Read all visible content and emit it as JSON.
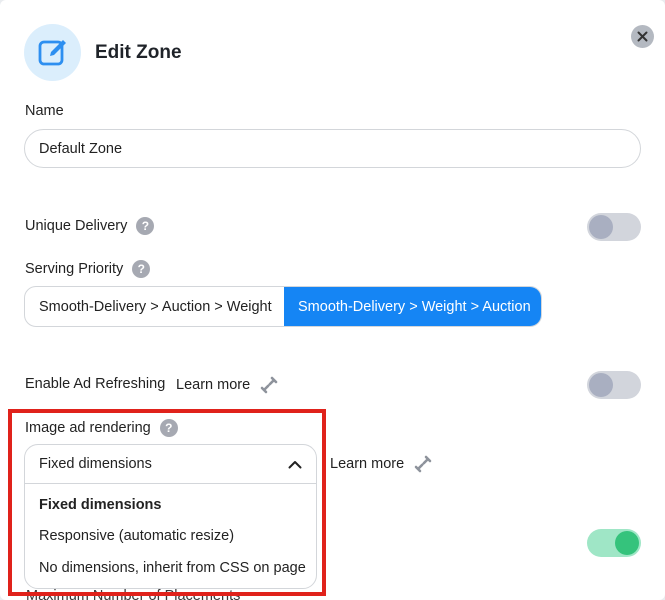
{
  "modal": {
    "title": "Edit Zone"
  },
  "name": {
    "label": "Name",
    "value": "Default Zone"
  },
  "unique_delivery": {
    "label": "Unique Delivery",
    "help": "?",
    "enabled": false
  },
  "serving_priority": {
    "label": "Serving Priority",
    "help": "?",
    "options": [
      "Smooth-Delivery > Auction > Weight",
      "Smooth-Delivery > Weight > Auction"
    ],
    "selected": "Smooth-Delivery > Weight > Auction"
  },
  "ad_refreshing": {
    "label": "Enable Ad Refreshing",
    "learn_more": "Learn more",
    "enabled": false
  },
  "image_ad_rendering": {
    "label": "Image ad rendering",
    "help": "?",
    "selected": "Fixed dimensions",
    "learn_more": "Learn more",
    "options": [
      "Fixed dimensions",
      "Responsive (automatic resize)",
      "No dimensions, inherit from CSS on page"
    ]
  },
  "hidden_toggle": {
    "enabled": true
  },
  "peek_label": "Maximum Number of Placements",
  "colors": {
    "accent": "#1585f4",
    "highlight": "#e0221b",
    "toggle_on": "#35c37c"
  }
}
